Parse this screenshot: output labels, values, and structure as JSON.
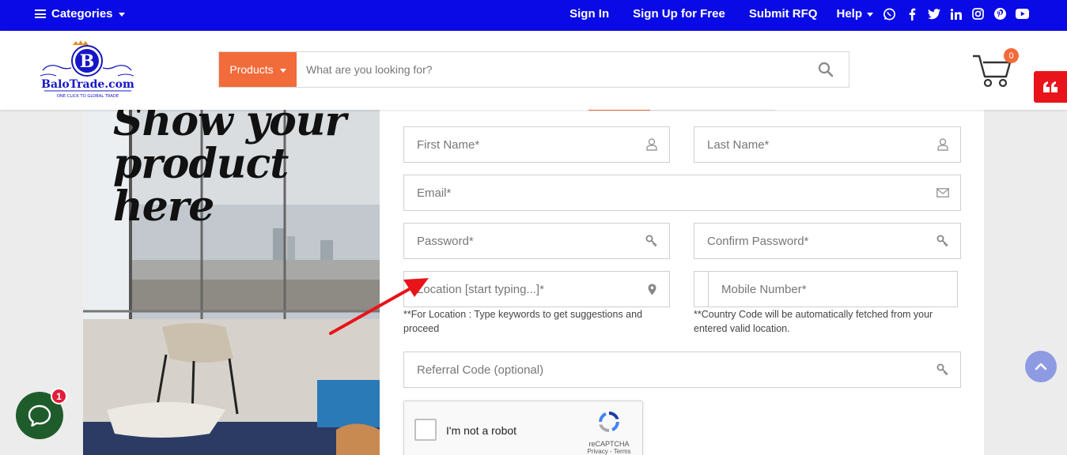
{
  "topbar": {
    "categories_label": "Categories",
    "links": {
      "sign_in": "Sign In",
      "sign_up": "Sign Up for Free",
      "submit_rfq": "Submit RFQ"
    },
    "help_label": "Help",
    "socials": [
      "whatsapp-icon",
      "facebook-icon",
      "twitter-icon",
      "linkedin-icon",
      "instagram-icon",
      "pinterest-icon",
      "youtube-icon"
    ],
    "bg_color": "#0a0ae6"
  },
  "header": {
    "logo": {
      "letter": "B",
      "name": "BaloTrade.com",
      "tagline": "ONE CLICK TO GLOBAL TRADE"
    },
    "search": {
      "category_label": "Products",
      "placeholder": "What are you looking for?"
    },
    "cart_count": "0",
    "accent_color": "#f26b3a"
  },
  "promo": {
    "lines": [
      "Show your",
      "product",
      "here"
    ]
  },
  "form": {
    "first_name_placeholder": "First Name*",
    "last_name_placeholder": "Last Name*",
    "email_placeholder": "Email*",
    "password_placeholder": "Password*",
    "confirm_password_placeholder": "Confirm Password*",
    "location_placeholder": "Location [start typing...]*",
    "mobile_placeholder": "Mobile Number*",
    "location_hint": "**For Location : Type keywords to get suggestions and proceed",
    "mobile_hint": "**Country Code will be automatically fetched from your entered valid location.",
    "referral_placeholder": "Referral Code (optional)",
    "captcha": {
      "label": "I'm not a robot",
      "brand": "reCAPTCHA",
      "links": "Privacy - Terms"
    }
  },
  "chat_badge": "1"
}
